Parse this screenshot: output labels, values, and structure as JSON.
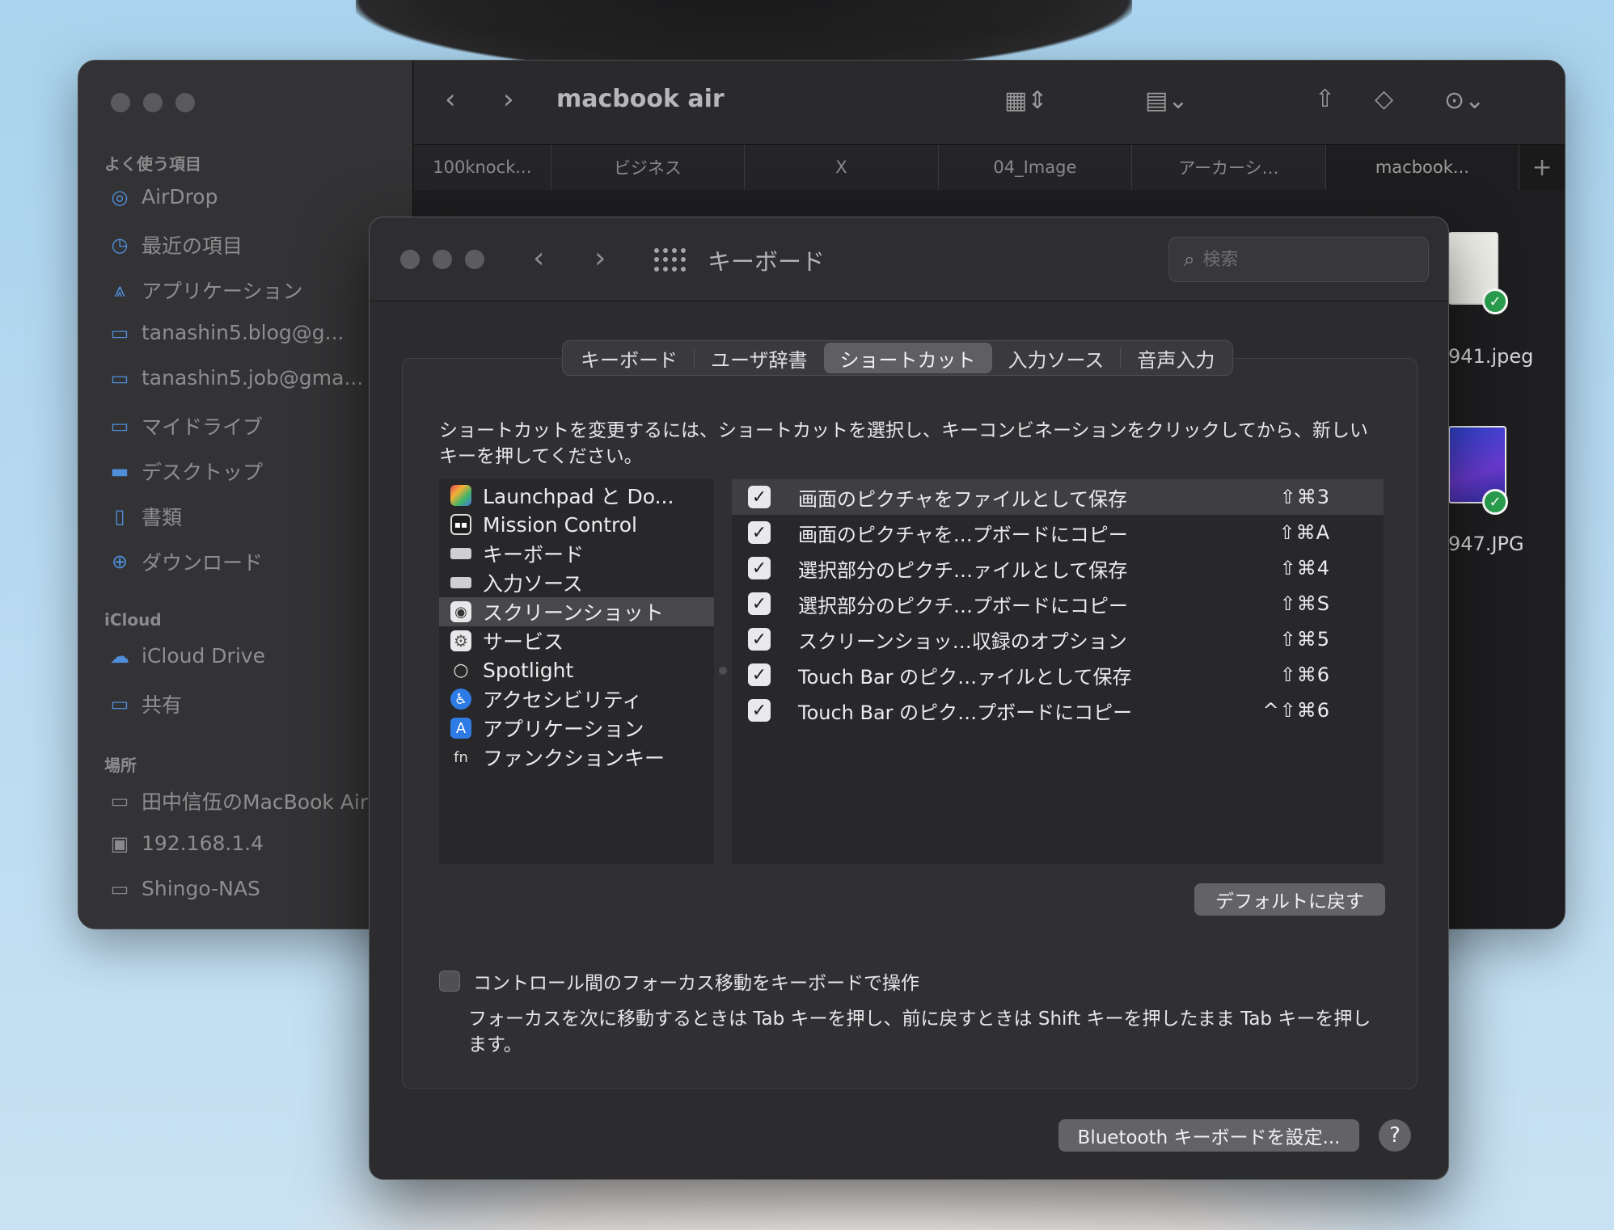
{
  "finder": {
    "title": "macbook air",
    "sidebar": {
      "favorites_header": "よく使う項目",
      "favorites": [
        {
          "label": "AirDrop",
          "icon": "airdrop-icon"
        },
        {
          "label": "最近の項目",
          "icon": "clock-icon"
        },
        {
          "label": "アプリケーション",
          "icon": "applications-icon"
        },
        {
          "label": "tanashin5.blog@g...",
          "icon": "folder-icon"
        },
        {
          "label": "tanashin5.job@gma...",
          "icon": "folder-icon"
        },
        {
          "label": "マイドライブ",
          "icon": "folder-icon"
        },
        {
          "label": "デスクトップ",
          "icon": "desktop-icon"
        },
        {
          "label": "書類",
          "icon": "document-icon"
        },
        {
          "label": "ダウンロード",
          "icon": "download-icon"
        }
      ],
      "icloud_header": "iCloud",
      "icloud": [
        {
          "label": "iCloud Drive",
          "icon": "cloud-icon"
        },
        {
          "label": "共有",
          "icon": "shared-folder-icon"
        }
      ],
      "locations_header": "場所",
      "locations": [
        {
          "label": "田中信伍のMacBook Air",
          "icon": "laptop-icon"
        },
        {
          "label": "192.168.1.4",
          "icon": "server-icon"
        },
        {
          "label": "Shingo-NAS",
          "icon": "display-icon"
        }
      ]
    },
    "tabs": [
      "100knock...",
      "ビジネス",
      "X",
      "04_Image",
      "アーカーシ…",
      "macbook..."
    ],
    "files": [
      "941.jpeg",
      "947.JPG"
    ]
  },
  "prefs": {
    "title": "キーボード",
    "search_placeholder": "検索",
    "tabs": [
      "キーボード",
      "ユーザ辞書",
      "ショートカット",
      "入力ソース",
      "音声入力"
    ],
    "active_tab": "ショートカット",
    "description": "ショートカットを変更するには、ショートカットを選択し、キーコンビネーションをクリックしてから、新しいキーを押してください。",
    "categories": [
      {
        "label": "Launchpad と Do...",
        "icon": "launchpad-icon",
        "color": "#6b5bd6"
      },
      {
        "label": "Mission Control",
        "icon": "mission-control-icon",
        "color": "#2b2b2d"
      },
      {
        "label": "キーボード",
        "icon": "keyboard-icon",
        "color": "#c9c9cb"
      },
      {
        "label": "入力ソース",
        "icon": "keyboard-icon",
        "color": "#c9c9cb"
      },
      {
        "label": "スクリーンショット",
        "icon": "screenshot-icon",
        "color": "#6e6e70"
      },
      {
        "label": "サービス",
        "icon": "gear-icon",
        "color": "#8e8e90"
      },
      {
        "label": "Spotlight",
        "icon": "spotlight-icon",
        "color": "#3a3a3c"
      },
      {
        "label": "アクセシビリティ",
        "icon": "accessibility-icon",
        "color": "#2f7be6"
      },
      {
        "label": "アプリケーション",
        "icon": "app-store-icon",
        "color": "#2f7be6"
      },
      {
        "label": "ファンクションキー",
        "icon": "fn-icon",
        "color": "#3a3a3c"
      }
    ],
    "selected_category": "スクリーンショット",
    "shortcuts": [
      {
        "label": "画面のピクチャをファイルとして保存",
        "keys": "⇧⌘3",
        "checked": true
      },
      {
        "label": "画面のピクチャを…プボードにコピー",
        "keys": "⇧⌘A",
        "checked": true
      },
      {
        "label": "選択部分のピクチ…ァイルとして保存",
        "keys": "⇧⌘4",
        "checked": true
      },
      {
        "label": "選択部分のピクチ…プボードにコピー",
        "keys": "⇧⌘S",
        "checked": true
      },
      {
        "label": "スクリーンショッ…収録のオプション",
        "keys": "⇧⌘5",
        "checked": true
      },
      {
        "label": "Touch Bar のピク…ァイルとして保存",
        "keys": "⇧⌘6",
        "checked": true
      },
      {
        "label": "Touch Bar のピク…プボードにコピー",
        "keys": "^⇧⌘6",
        "checked": true
      }
    ],
    "restore_defaults": "デフォルトに戻す",
    "focus_checkbox_label": "コントロール間のフォーカス移動をキーボードで操作",
    "focus_checked": false,
    "focus_description": "フォーカスを次に移動するときは Tab キーを押し、前に戻すときは Shift キーを押したまま Tab キーを押します。",
    "bluetooth_button": "Bluetooth キーボードを設定...",
    "help_button": "?"
  }
}
